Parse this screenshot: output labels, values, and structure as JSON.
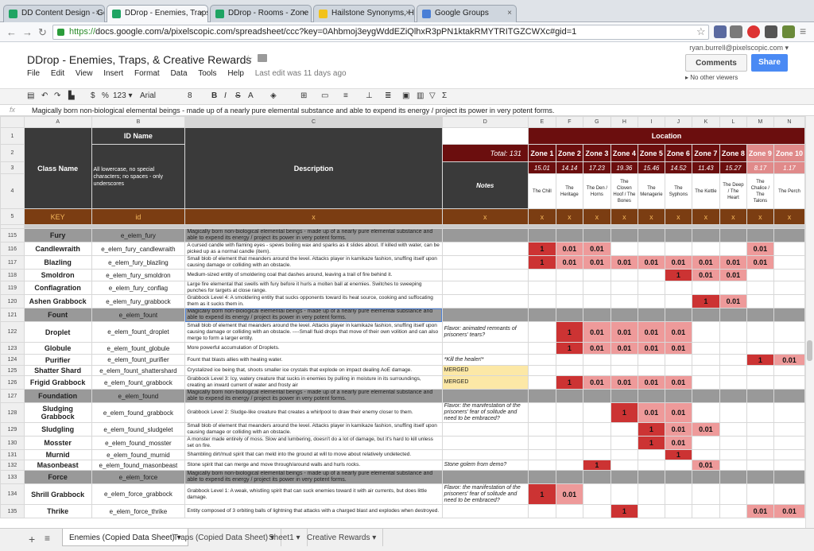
{
  "browser": {
    "tabs": [
      {
        "label": "DD Content Design - Goo",
        "color": "#1fa463"
      },
      {
        "label": "DDrop - Enemies, Traps, &",
        "color": "#1fa463"
      },
      {
        "label": "DDrop - Rooms - Zone 1",
        "color": "#1fa463"
      },
      {
        "label": "Hailstone Synonyms, Hail",
        "color": "#f2c21b"
      },
      {
        "label": "Google Groups",
        "color": "#4a7fd6"
      }
    ],
    "close_glyph": "×",
    "url_scheme": "https://",
    "url_rest": "docs.google.com/a/pixelscopic.com/spreadsheet/ccc?key=0Ahbmoj3eygWddEZiQlhxR3pPN1ktakRMYTRITGZCWXc#gid=1"
  },
  "doc": {
    "title": "DDrop - Enemies, Traps, & Creative Rewards",
    "star": "☆",
    "user": "ryan.burrell@pixelscopic.com ▾",
    "comments": "Comments",
    "share": "Share",
    "viewers": "No other viewers",
    "menus": [
      "File",
      "Edit",
      "View",
      "Insert",
      "Format",
      "Data",
      "Tools",
      "Help"
    ],
    "last_edit": "Last edit was 11 days ago"
  },
  "toolbar": {
    "currency": "$",
    "percent": "%",
    "format": "123 ▾",
    "font": "Arial",
    "size": "8"
  },
  "formula": {
    "fx": "fx",
    "text": "Magically born non-biological elemental beings - made up of a nearly pure elemental substance and able to expend its energy / project its power in very potent forms."
  },
  "columns": [
    "A",
    "B",
    "C",
    "D",
    "E",
    "F",
    "G",
    "H",
    "I",
    "J",
    "K",
    "L",
    "M",
    "N"
  ],
  "header": {
    "id_name": "ID Name",
    "class_name": "Class Name",
    "id_note": "All lowercase, no special characters; no spaces - only underscores",
    "description": "Description",
    "location": "Location",
    "total": "Total: 131",
    "notes": "Notes",
    "zones": [
      "Zone 1",
      "Zone 2",
      "Zone 3",
      "Zone 4",
      "Zone 5",
      "Zone 6",
      "Zone 7",
      "Zone 8",
      "Zone 9",
      "Zone 10"
    ],
    "zone_vals": [
      "15.01",
      "14.14",
      "17.23",
      "19.36",
      "15.46",
      "14.52",
      "11.43",
      "15.27",
      "8.17",
      "1.17"
    ],
    "zone_names": [
      "The Chill",
      "The Heritage",
      "The Den / Horns",
      "The Cloven Hoof / The Bones",
      "The Menagerie",
      "The Syphons",
      "The Kettle",
      "The Deep / The Heart",
      "The Chalice / The Talons",
      "The Perch"
    ],
    "key": "KEY",
    "key_id": "id",
    "x": "x"
  },
  "row_numbers": [
    "1",
    "2",
    "3",
    "4",
    "5"
  ],
  "rows": [
    {
      "n": "115",
      "cat": true,
      "name": "Fury",
      "id": "e_elem_fury",
      "desc": "Magically born non-biological elemental beings - made up of a nearly pure elemental substance and able to expend its energy / project its power in very potent forms.",
      "note": "",
      "vals": [
        "",
        "",
        "",
        "",
        "",
        "",
        "",
        "",
        "",
        ""
      ]
    },
    {
      "n": "116",
      "name": "Candlewraith",
      "id": "e_elem_fury_candlewraith",
      "desc": "A cursed candle with flaming eyes - spews boiling wax and sparks as it slides about. If killed with water, can be picked up as a normal candle (item).",
      "note": "",
      "vals": [
        "1",
        "0.01",
        "0.01",
        "",
        "",
        "",
        "",
        "",
        "0.01",
        ""
      ]
    },
    {
      "n": "117",
      "name": "Blazling",
      "id": "e_elem_fury_blazling",
      "desc": "Small blob of element that meanders around the level. Attacks player in kamikaze fashion, snuffing itself upon causing damage or colliding with an obstacle.",
      "note": "",
      "vals": [
        "1",
        "0.01",
        "0.01",
        "0.01",
        "0.01",
        "0.01",
        "0.01",
        "0.01",
        "0.01",
        ""
      ]
    },
    {
      "n": "118",
      "name": "Smoldron",
      "id": "e_elem_fury_smoldron",
      "desc": "Medium-sized entity of smoldering coal that dashes around, leaving a trail of fire behind it.",
      "note": "",
      "vals": [
        "",
        "",
        "",
        "",
        "",
        "1",
        "0.01",
        "0.01",
        "",
        ""
      ]
    },
    {
      "n": "119",
      "name": "Conflagration",
      "id": "e_elem_fury_conflag",
      "desc": "Large fire elemental that swells with fury before it hurls a molten ball at enemies. Switches to sweeping punches for targets at close range.",
      "note": "",
      "vals": [
        "",
        "",
        "",
        "",
        "",
        "",
        "",
        "",
        "",
        ""
      ]
    },
    {
      "n": "120",
      "name": "Ashen Grabbock",
      "id": "e_elem_fury_grabbock",
      "desc": "Grabbock Level 4: A smoldering entity that sucks opponents toward its heat source, cooking and suffocating them as it sucks them in.",
      "note": "",
      "vals": [
        "",
        "",
        "",
        "",
        "",
        "",
        "1",
        "0.01",
        "",
        ""
      ]
    },
    {
      "n": "121",
      "cat": true,
      "sel": true,
      "name": "Fount",
      "id": "e_elem_fount",
      "desc": "Magically born non-biological elemental beings - made up of a nearly pure elemental substance and able to expend its energy / project its power in very potent forms.",
      "note": "",
      "vals": [
        "",
        "",
        "",
        "",
        "",
        "",
        "",
        "",
        "",
        ""
      ]
    },
    {
      "n": "122",
      "name": "Droplet",
      "id": "e_elem_fount_droplet",
      "desc": "Small blob of element that meanders around the level. Attacks player in kamikaze fashion, snuffing itself upon causing damage or colliding with an obstacle. ----Small fluid drops that move of their own volition and can also merge to form a larger entity.",
      "note": "Flavor: animated remnants of prisoners' tears?",
      "vals": [
        "",
        "1",
        "0.01",
        "0.01",
        "0.01",
        "0.01",
        "",
        "",
        "",
        ""
      ]
    },
    {
      "n": "123",
      "name": "Globule",
      "id": "e_elem_fount_globule",
      "desc": "More powerful accumulation of Droplets.",
      "note": "",
      "vals": [
        "",
        "1",
        "0.01",
        "0.01",
        "0.01",
        "0.01",
        "",
        "",
        "",
        ""
      ]
    },
    {
      "n": "124",
      "name": "Purifier",
      "id": "e_elem_fount_purifier",
      "desc": "Fount that blasts allies with healing water.",
      "note": "*Kill the healer!*",
      "vals": [
        "",
        "",
        "",
        "",
        "",
        "",
        "",
        "",
        "1",
        "0.01"
      ]
    },
    {
      "n": "125",
      "name": "Shatter Shard",
      "id": "e_elem_fount_shattershard",
      "desc": "Crystalized ice being that, shoots smaller ice crystals that explode on impact dealing AoE damage.",
      "note": "MERGED",
      "merged": true,
      "vals": [
        "",
        "",
        "",
        "",
        "",
        "",
        "",
        "",
        "",
        ""
      ]
    },
    {
      "n": "126",
      "name": "Frigid Grabbock",
      "id": "e_elem_fount_grabbock",
      "desc": "Grabbock Level 3: Icy, watery creature that sucks in enemies by pulling in moisture in its surroundings, creating an inward current of water and frosty air",
      "note": "MERGED",
      "merged": true,
      "vals": [
        "",
        "1",
        "0.01",
        "0.01",
        "0.01",
        "0.01",
        "",
        "",
        "",
        ""
      ]
    },
    {
      "n": "127",
      "cat": true,
      "name": "Foundation",
      "id": "e_elem_found",
      "desc": "Magically born non-biological elemental beings - made up of a nearly pure elemental substance and able to expend its energy / project its power in very potent forms.",
      "note": "",
      "vals": [
        "",
        "",
        "",
        "",
        "",
        "",
        "",
        "",
        "",
        ""
      ]
    },
    {
      "n": "128",
      "name": "Sludging Grabbock",
      "id": "e_elem_found_grabbock",
      "desc": "Grabbock Level 2: Sludge-like creature that creates a whirlpool to draw their enemy closer to them.",
      "note": "Flavor: the manifestation of the prisoners' fear of solitude and need to be embraced?",
      "vals": [
        "",
        "",
        "",
        "1",
        "0.01",
        "0.01",
        "",
        "",
        "",
        ""
      ]
    },
    {
      "n": "129",
      "name": "Sludgling",
      "id": "e_elem_found_sludgelet",
      "desc": "Small blob of element that meanders around the level. Attacks player in kamikaze fashion, snuffing itself upon causing damage or colliding with an obstacle.",
      "note": "",
      "vals": [
        "",
        "",
        "",
        "",
        "1",
        "0.01",
        "0.01",
        "",
        "",
        ""
      ]
    },
    {
      "n": "130",
      "name": "Mosster",
      "id": "e_elem_found_mosster",
      "desc": "A monster made entirely of moss. Slow and lumbering, doesn't do a lot of damage, but it's hard to kill unless set on fire.",
      "note": "",
      "vals": [
        "",
        "",
        "",
        "",
        "1",
        "0.01",
        "",
        "",
        "",
        ""
      ]
    },
    {
      "n": "131",
      "name": "Murnid",
      "id": "e_elem_found_murnid",
      "desc": "Shambling dirt/mud spirit that can meld into the ground at will to move about relatively undetected.",
      "note": "",
      "vals": [
        "",
        "",
        "",
        "",
        "",
        "1",
        "",
        "",
        "",
        ""
      ]
    },
    {
      "n": "132",
      "name": "Masonbeast",
      "id": "e_elem_found_masonbeast",
      "desc": "Stone spirit that can merge and move through/around walls and hurls rocks.",
      "note": "Stone golem from demo?",
      "vals": [
        "",
        "",
        "1",
        "",
        "",
        "",
        "0.01",
        "",
        "",
        ""
      ]
    },
    {
      "n": "133",
      "cat": true,
      "name": "Force",
      "id": "e_elem_force",
      "desc": "Magically born non-biological elemental beings - made up of a nearly pure elemental substance and able to expend its energy / project its power in very potent forms.",
      "note": "",
      "vals": [
        "",
        "",
        "",
        "",
        "",
        "",
        "",
        "",
        "",
        ""
      ]
    },
    {
      "n": "134",
      "name": "Shrill Grabbock",
      "id": "e_elem_force_grabbock",
      "desc": "Grabbock Level 1: A weak, whistling spirit that can suck enemies toward it with air currents, but does little damage.",
      "note": "Flavor: the manifestation of the prisoners' fear of solitude and need to be embraced?",
      "vals": [
        "1",
        "0.01",
        "",
        "",
        "",
        "",
        "",
        "",
        "",
        ""
      ]
    },
    {
      "n": "135",
      "name": "Thrike",
      "id": "e_elem_force_thrike",
      "desc": "Entity composed of 3 orbiting balls of lightning that attacks with a charged blast and explodes when destroyed.",
      "note": "",
      "vals": [
        "",
        "",
        "",
        "1",
        "",
        "",
        "",
        "",
        "0.01",
        "0.01"
      ]
    }
  ],
  "sheets": [
    "Enemies (Copied Data Sheet)",
    "Traps (Copied Data Sheet)",
    "Sheet1",
    "Creative Rewards"
  ],
  "sheet_glyphs": {
    "add": "+",
    "list": "≡",
    "arrow": "▾"
  }
}
